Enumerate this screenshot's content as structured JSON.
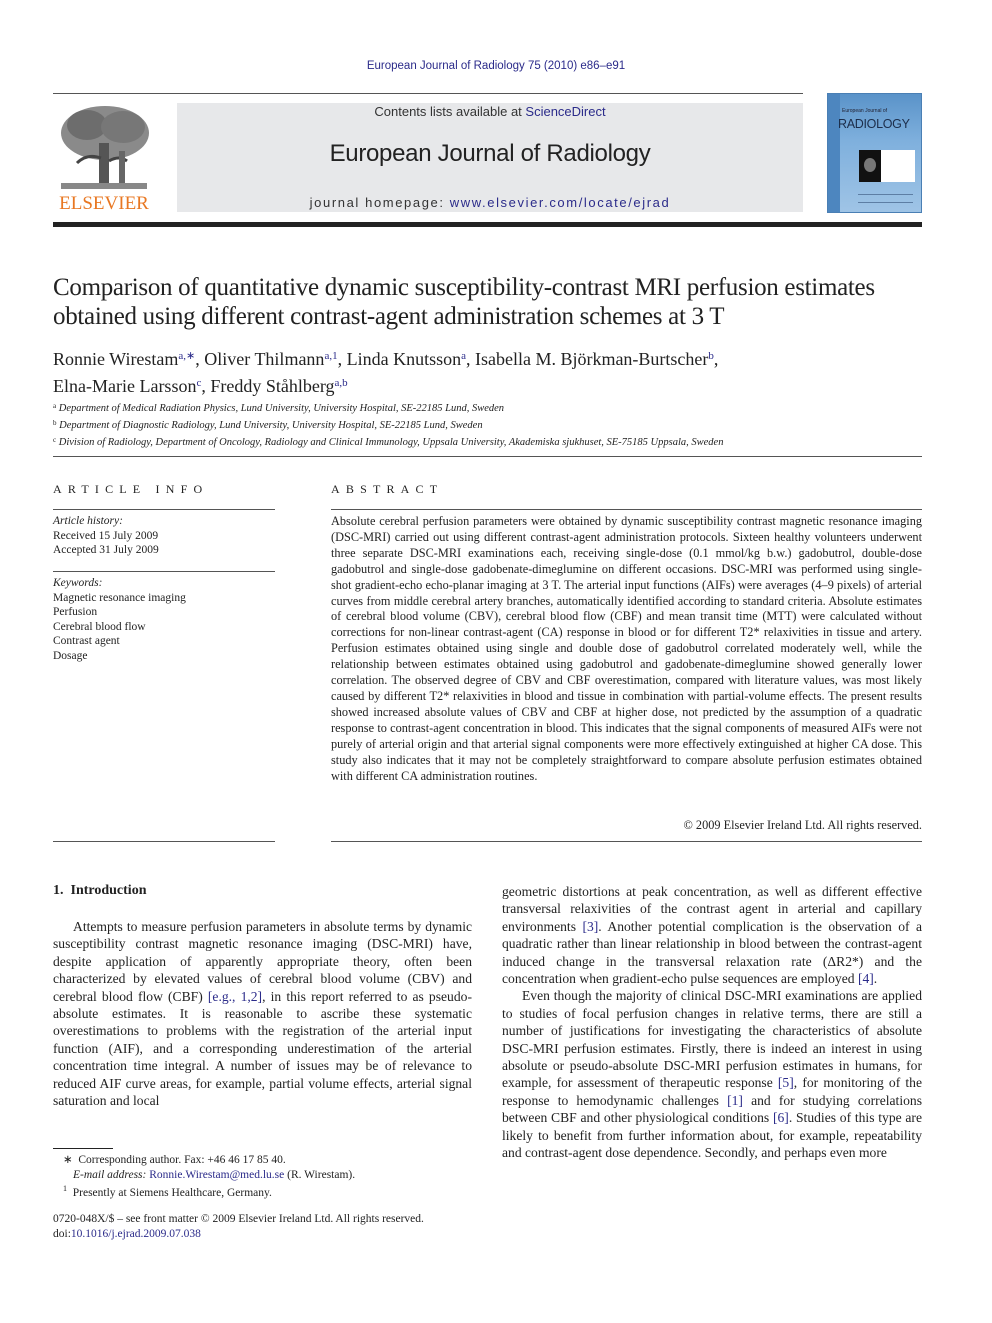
{
  "header": {
    "journal_reference": "European Journal of Radiology 75 (2010) e86–e91",
    "contents_prefix": "Contents lists available at ",
    "contents_link": "ScienceDirect",
    "journal_title": "European Journal of Radiology",
    "homepage_prefix": "journal homepage: ",
    "homepage_link": "www.elsevier.com/locate/ejrad",
    "publisher_logo_text": "ELSEVIER",
    "cover_small_text": "European Journal of",
    "cover_title": "RADIOLOGY"
  },
  "article": {
    "title": "Comparison of quantitative dynamic susceptibility-contrast MRI perfusion estimates obtained using different contrast-agent administration schemes at 3 T",
    "authors": [
      {
        "name": "Ronnie Wirestam",
        "sup": "a,∗",
        "sep": ", "
      },
      {
        "name": "Oliver Thilmann",
        "sup": "a,1",
        "sep": ", "
      },
      {
        "name": "Linda Knutsson",
        "sup": "a",
        "sep": ", "
      },
      {
        "name": "Isabella M. Björkman-Burtscher",
        "sup": "b",
        "sep": ","
      },
      {
        "name": "Elna-Marie Larsson",
        "sup": "c",
        "sep": ", "
      },
      {
        "name": "Freddy Ståhlberg",
        "sup": "a,b",
        "sep": ""
      }
    ],
    "affiliations": [
      {
        "key": "a",
        "text": "Department of Medical Radiation Physics, Lund University, University Hospital, SE-22185 Lund, Sweden"
      },
      {
        "key": "b",
        "text": "Department of Diagnostic Radiology, Lund University, University Hospital, SE-22185 Lund, Sweden"
      },
      {
        "key": "c",
        "text": "Division of Radiology, Department of Oncology, Radiology and Clinical Immunology, Uppsala University, Akademiska sjukhuset, SE-75185 Uppsala, Sweden"
      }
    ]
  },
  "article_info": {
    "heading": "ARTICLE INFO",
    "history_label": "Article history:",
    "received": "Received 15 July 2009",
    "accepted": "Accepted 31 July 2009",
    "keywords_label": "Keywords:",
    "keywords": [
      "Magnetic resonance imaging",
      "Perfusion",
      "Cerebral blood flow",
      "Contrast agent",
      "Dosage"
    ]
  },
  "abstract": {
    "heading": "ABSTRACT",
    "text": "Absolute cerebral perfusion parameters were obtained by dynamic susceptibility contrast magnetic resonance imaging (DSC-MRI) carried out using different contrast-agent administration protocols. Sixteen healthy volunteers underwent three separate DSC-MRI examinations each, receiving single-dose (0.1 mmol/kg b.w.) gadobutrol, double-dose gadobutrol and single-dose gadobenate-dimeglumine on different occasions. DSC-MRI was performed using single-shot gradient-echo echo-planar imaging at 3 T. The arterial input functions (AIFs) were averages (4–9 pixels) of arterial curves from middle cerebral artery branches, automatically identified according to standard criteria. Absolute estimates of cerebral blood volume (CBV), cerebral blood flow (CBF) and mean transit time (MTT) were calculated without corrections for non-linear contrast-agent (CA) response in blood or for different T2* relaxivities in tissue and artery. Perfusion estimates obtained using single and double dose of gadobutrol correlated moderately well, while the relationship between estimates obtained using gadobutrol and gadobenate-dimeglumine showed generally lower correlation. The observed degree of CBV and CBF overestimation, compared with literature values, was most likely caused by different T2* relaxivities in blood and tissue in combination with partial-volume effects. The present results showed increased absolute values of CBV and CBF at higher dose, not predicted by the assumption of a quadratic response to contrast-agent concentration in blood. This indicates that the signal components of measured AIFs were not purely of arterial origin and that arterial signal components were more effectively extinguished at higher CA dose. This study also indicates that it may not be completely straightforward to compare absolute perfusion estimates obtained with different CA administration routines.",
    "copyright": "© 2009 Elsevier Ireland Ltd. All rights reserved."
  },
  "introduction": {
    "heading": "1.  Introduction",
    "left_p1_a": "Attempts to measure perfusion parameters in absolute terms by dynamic susceptibility contrast magnetic resonance imaging (DSC-MRI) have, despite application of apparently appropriate theory, often been characterized by elevated values of cerebral blood volume (CBV) and cerebral blood flow (CBF) ",
    "left_p1_ref": "[e.g., 1,2]",
    "left_p1_b": ", in this report referred to as pseudo-absolute estimates. It is reasonable to ascribe these systematic overestimations to problems with the registration of the arterial input function (AIF), and a corresponding underestimation of the arterial concentration time integral. A number of issues may be of relevance to reduced AIF curve areas, for example, partial volume effects, arterial signal saturation and local",
    "right_p1_a": "geometric distortions at peak concentration, as well as different effective transversal relaxivities of the contrast agent in arterial and capillary environments ",
    "right_p1_ref1": "[3]",
    "right_p1_b": ". Another potential complication is the observation of a quadratic rather than linear relationship in blood between the contrast-agent induced change in the transversal relaxation rate (ΔR2*) and the concentration when gradient-echo pulse sequences are employed ",
    "right_p1_ref2": "[4]",
    "right_p1_c": ".",
    "right_p2_a": "Even though the majority of clinical DSC-MRI examinations are applied to studies of focal perfusion changes in relative terms, there are still a number of justifications for investigating the characteristics of absolute DSC-MRI perfusion estimates. Firstly, there is indeed an interest in using absolute or pseudo-absolute DSC-MRI perfusion estimates in humans, for example, for assessment of therapeutic response ",
    "right_p2_ref1": "[5]",
    "right_p2_b": ", for monitoring of the response to hemodynamic challenges ",
    "right_p2_ref2": "[1]",
    "right_p2_c": " and for studying correlations between CBF and other physiological conditions ",
    "right_p2_ref3": "[6]",
    "right_p2_d": ". Studies of this type are likely to benefit from further information about, for example, repeatability and contrast-agent dose dependence. Secondly, and perhaps even more"
  },
  "footnotes": {
    "corresponding_mark": "∗",
    "corresponding": "Corresponding author. Fax: +46 46 17 85 40.",
    "email_label": "E-mail address: ",
    "email": "Ronnie.Wirestam@med.lu.se",
    "email_suffix": " (R. Wirestam).",
    "fn1_mark": "1",
    "fn1": "Presently at Siemens Healthcare, Germany.",
    "front_matter": "0720-048X/$ – see front matter © 2009 Elsevier Ireland Ltd. All rights reserved.",
    "doi_label": "doi:",
    "doi": "10.1016/j.ejrad.2009.07.038"
  }
}
